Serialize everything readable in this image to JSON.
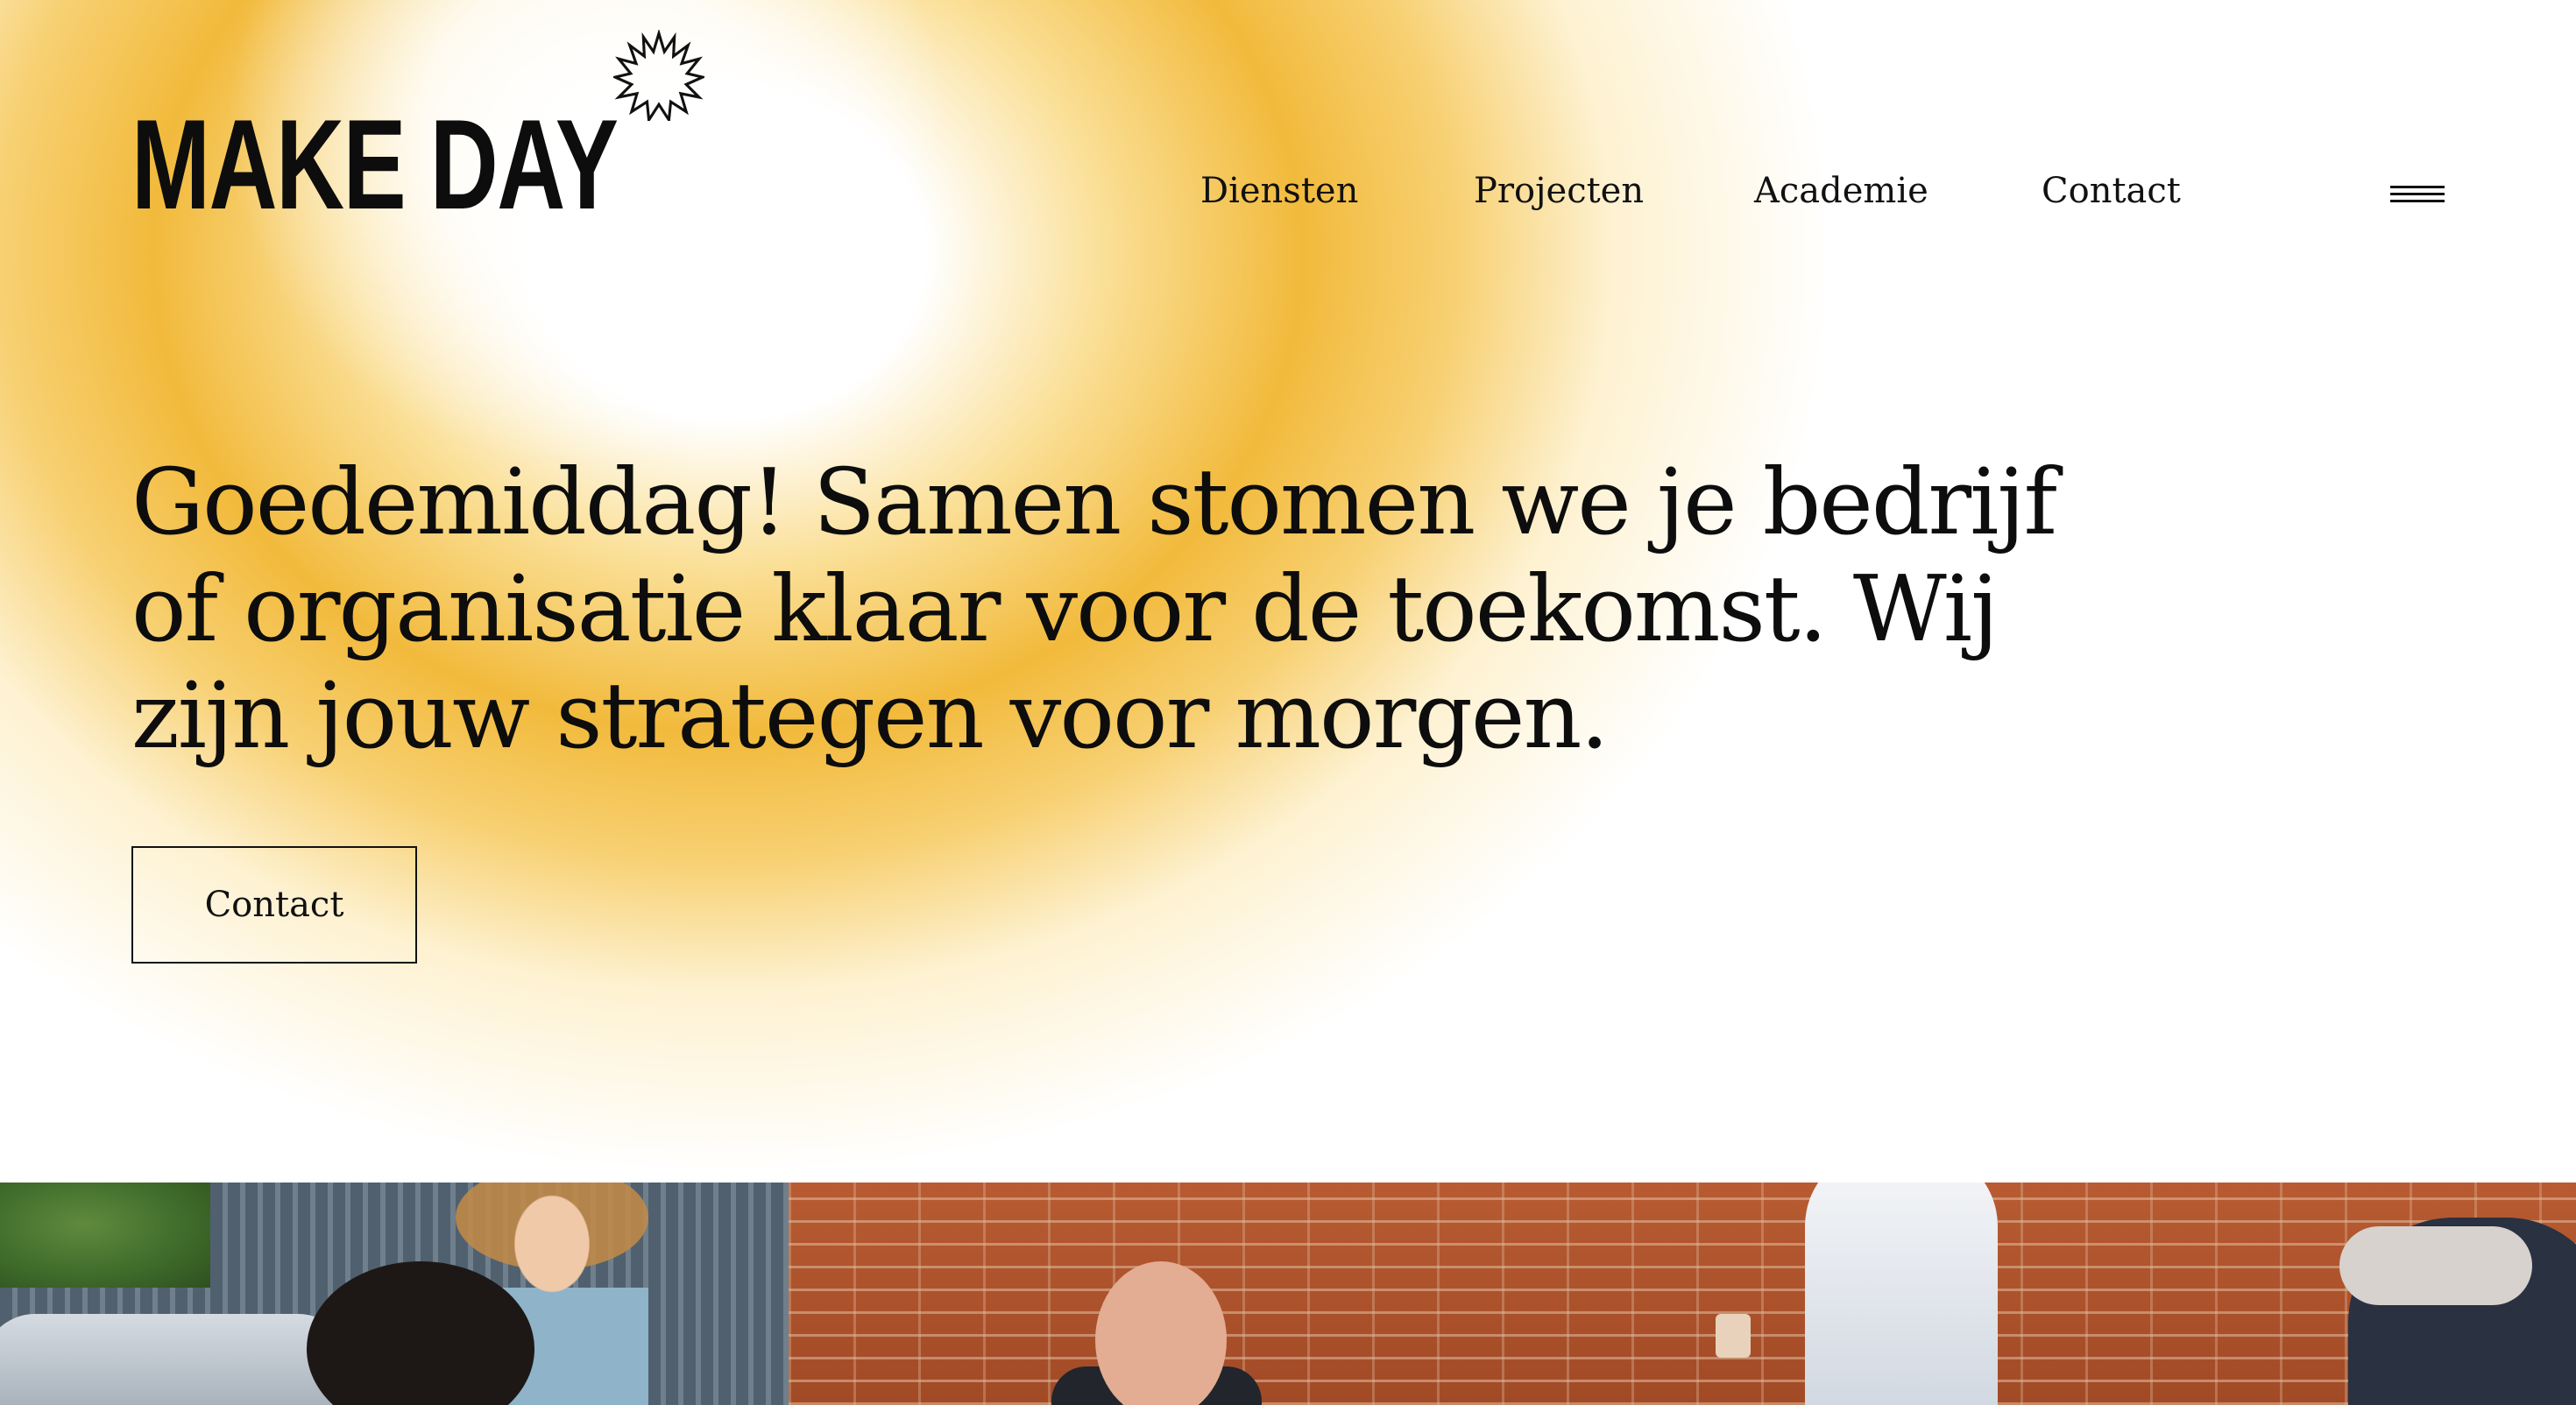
{
  "brand": {
    "name": "MAKE DAY",
    "logo_icon": "starburst-icon",
    "accent_color": "#F2BA3C"
  },
  "nav": {
    "items": [
      {
        "label": "Diensten"
      },
      {
        "label": "Projecten"
      },
      {
        "label": "Academie"
      },
      {
        "label": "Contact"
      }
    ],
    "menu_icon": "hamburger-menu-icon"
  },
  "hero": {
    "heading": "Goedemiddag! Samen stomen we je bedrijf of organisatie klaar voor de toekomst. Wij zijn jouw strategen voor morgen.",
    "cta_label": "Contact"
  },
  "photo": {
    "subject": "group-photo"
  }
}
